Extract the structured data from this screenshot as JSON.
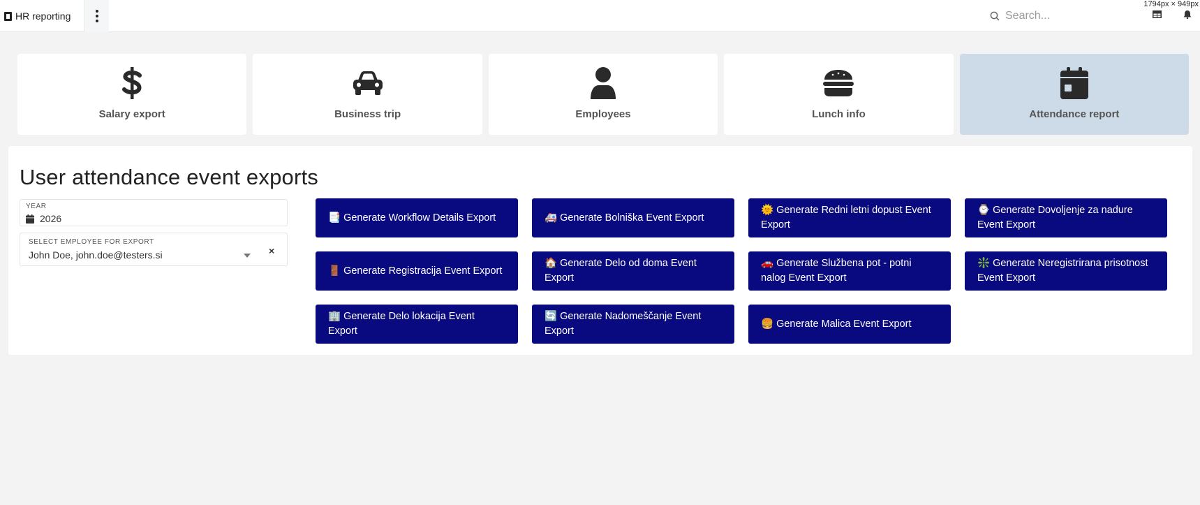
{
  "topbar": {
    "app_title": "HR reporting",
    "search_placeholder": "Search...",
    "dimensions": "1794px × 949px"
  },
  "nav_cards": [
    {
      "label": "Salary export",
      "icon": "dollar-icon",
      "active": false
    },
    {
      "label": "Business trip",
      "icon": "car-icon",
      "active": false
    },
    {
      "label": "Employees",
      "icon": "user-icon",
      "active": false
    },
    {
      "label": "Lunch info",
      "icon": "burger-icon",
      "active": false
    },
    {
      "label": "Attendance report",
      "icon": "calendar-icon",
      "active": true
    }
  ],
  "main": {
    "title": "User attendance event exports",
    "year": {
      "label": "YEAR",
      "value": "2026"
    },
    "employee": {
      "label": "SELECT EMPLOYEE FOR EXPORT",
      "value": "John Doe, john.doe@testers.si",
      "clear": "×"
    }
  },
  "buttons": [
    {
      "emoji": "📑",
      "label": "Generate Workflow Details Export"
    },
    {
      "emoji": "🚑",
      "label": "Generate Bolniška Event Export"
    },
    {
      "emoji": "🌞",
      "label": "Generate Redni letni dopust Event Export"
    },
    {
      "emoji": "⌚",
      "label": "Generate Dovoljenje za nadure Event Export"
    },
    {
      "emoji": "🚪",
      "label": "Generate Registracija Event Export"
    },
    {
      "emoji": "🏠",
      "label": "Generate Delo od doma Event Export"
    },
    {
      "emoji": "🚗",
      "label": "Generate Službena pot - potni nalog Event Export"
    },
    {
      "emoji": "❇️",
      "label": "Generate Neregistrirana prisotnost Event Export"
    },
    {
      "emoji": "🏢",
      "label": "Generate Delo lokacija Event Export"
    },
    {
      "emoji": "🔄",
      "label": "Generate Nadomeščanje Event Export"
    },
    {
      "emoji": "🍔",
      "label": "Generate Malica Event Export"
    }
  ],
  "colors": {
    "button_bg": "#0a0a80",
    "active_card_bg": "#cddbe8",
    "page_bg": "#f3f3f3"
  }
}
